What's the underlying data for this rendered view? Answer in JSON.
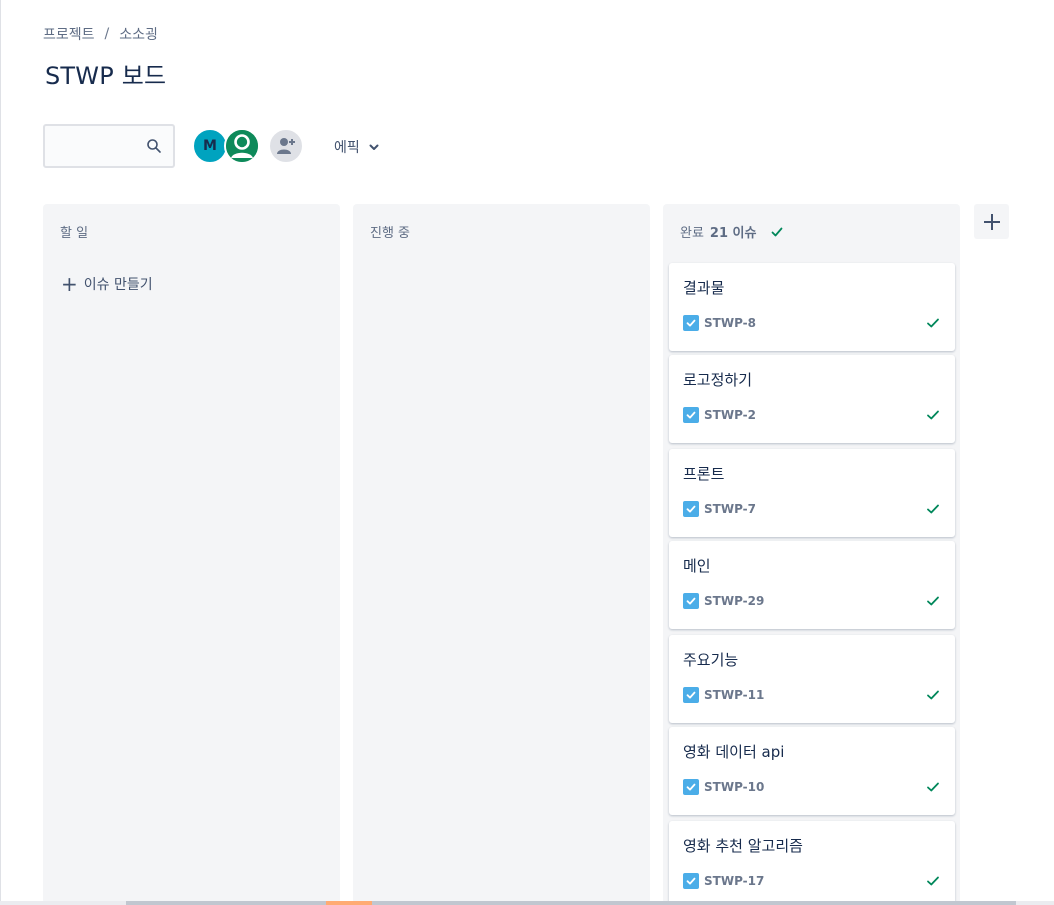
{
  "breadcrumb": {
    "items": [
      "프로젝트",
      "소소굉"
    ],
    "separator": "/"
  },
  "page": {
    "title": "STWP 보드"
  },
  "filters": {
    "search_value": "",
    "avatar_m_initial": "M",
    "epic_label": "에픽"
  },
  "columns": [
    {
      "name": "할 일",
      "count": ""
    },
    {
      "name": "진행 중",
      "count": ""
    },
    {
      "name": "완료",
      "count": "21 이슈"
    }
  ],
  "todo": {
    "create_label": "이슈 만들기"
  },
  "done_cards": [
    {
      "title": "결과물",
      "key": "STWP-8"
    },
    {
      "title": "로고정하기",
      "key": "STWP-2"
    },
    {
      "title": "프론트",
      "key": "STWP-7"
    },
    {
      "title": "메인",
      "key": "STWP-29"
    },
    {
      "title": "주요기능",
      "key": "STWP-11"
    },
    {
      "title": "영화 데이터 api",
      "key": "STWP-10"
    },
    {
      "title": "영화 추천 알고리즘",
      "key": "STWP-17"
    }
  ],
  "colors": {
    "task_icon": "#4bade8",
    "done_check": "#00875a",
    "column_bg": "#f4f5f7",
    "avatar_m": "#00a3bf",
    "avatar_user": "#0e8a5a"
  }
}
